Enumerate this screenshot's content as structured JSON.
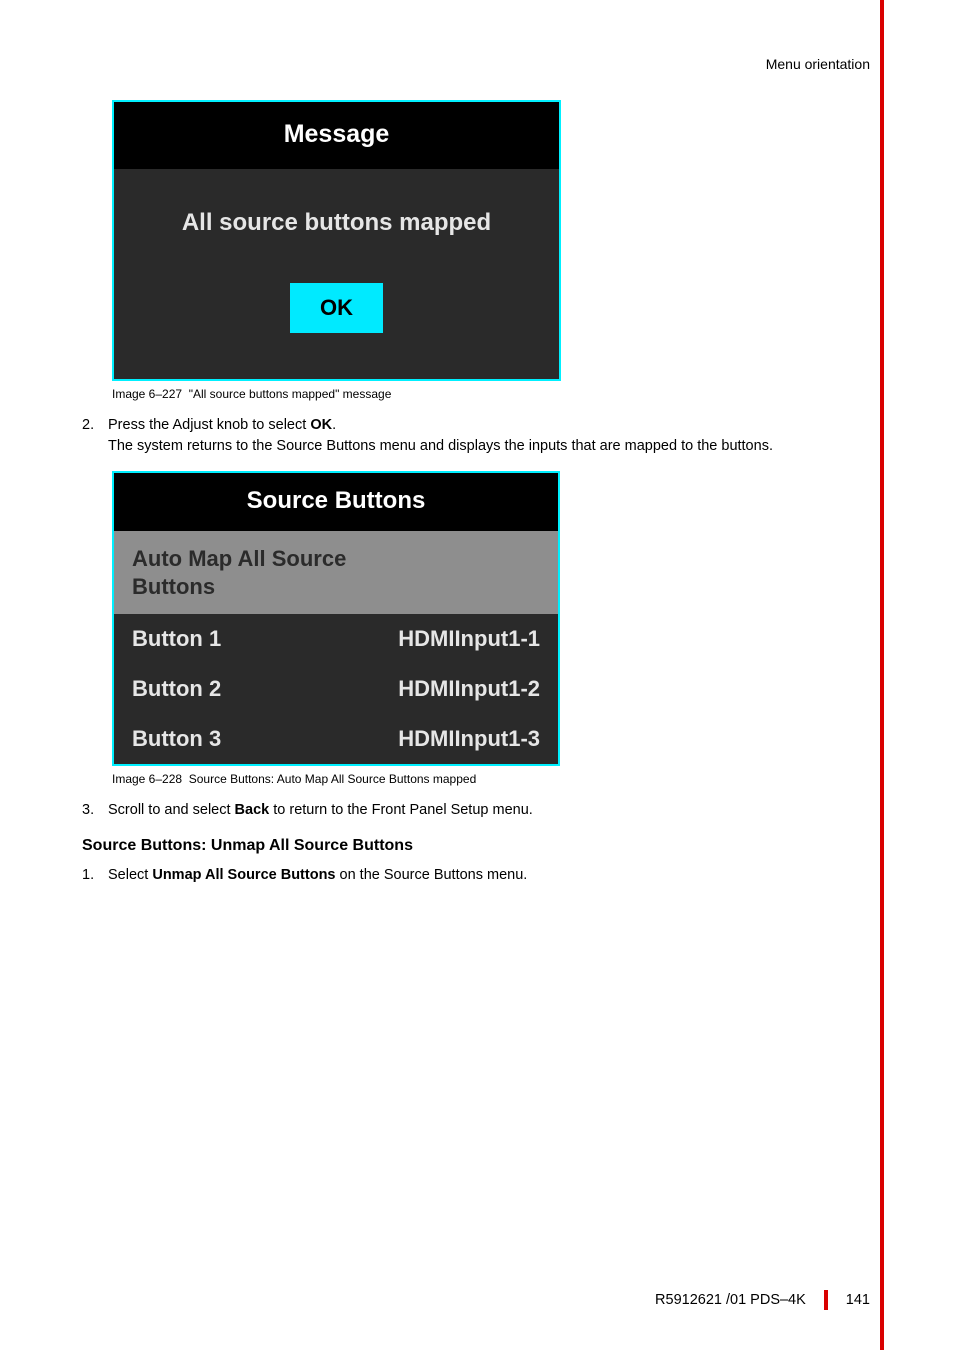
{
  "header": {
    "section": "Menu orientation"
  },
  "fig1": {
    "title": "Message",
    "message": "All source buttons mapped",
    "ok": "OK",
    "caption_prefix": "Image 6–227",
    "caption_text": "\"All source buttons mapped\" message"
  },
  "step2": {
    "num": "2.",
    "line1a": "Press the Adjust knob to select ",
    "line1b": "OK",
    "line1c": ".",
    "line2": "The system returns to the Source Buttons menu and displays the inputs that are mapped to the buttons."
  },
  "fig2": {
    "title": "Source Buttons",
    "row_sel": "Auto Map All Source Buttons",
    "rows": [
      {
        "label": "Button 1",
        "value": "HDMIInput1-1"
      },
      {
        "label": "Button 2",
        "value": "HDMIInput1-2"
      },
      {
        "label": "Button 3",
        "value": "HDMIInput1-3"
      }
    ],
    "caption_prefix": "Image 6–228",
    "caption_text": "Source Buttons: Auto Map All Source Buttons mapped"
  },
  "step3": {
    "num": "3.",
    "a": "Scroll to and select ",
    "b": "Back",
    "c": " to return to the Front Panel Setup menu."
  },
  "section": {
    "heading": "Source Buttons: Unmap All Source Buttons"
  },
  "step1b": {
    "num": "1.",
    "a": "Select ",
    "b": "Unmap All Source Buttons",
    "c": " on the Source Buttons menu."
  },
  "footer": {
    "doc": "R5912621 /01 PDS–4K",
    "page": "141"
  }
}
